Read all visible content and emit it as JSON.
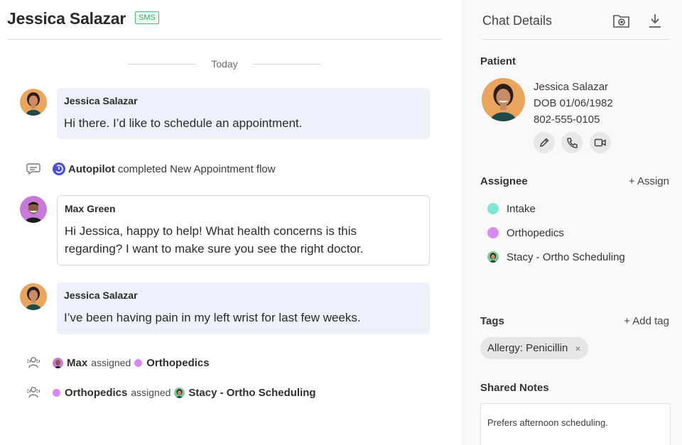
{
  "chat": {
    "title": "Jessica Salazar",
    "channel_badge": "SMS",
    "date_divider": "Today",
    "messages": [
      {
        "sender": "Jessica Salazar",
        "text": "Hi there. I’d like to schedule an appointment."
      },
      {
        "sender": "Max Green",
        "text": "Hi Jessica, happy to help! What health concerns is this regarding? I want to make sure you see the right doctor."
      },
      {
        "sender": "Jessica Salazar",
        "text": "I’ve been having pain in my left wrist for last few weeks."
      }
    ],
    "events": {
      "autopilot": {
        "actor": "Autopilot",
        "text": "completed New Appointment flow"
      },
      "assign1": {
        "actor": "Max",
        "verb": "assigned",
        "target": "Orthopedics"
      },
      "assign2": {
        "actor": "Orthopedics",
        "verb": "assigned",
        "target": "Stacy - Ortho Scheduling"
      }
    }
  },
  "details": {
    "title": "Chat Details",
    "patient_label": "Patient",
    "patient": {
      "name": "Jessica Salazar",
      "dob": "DOB 01/06/1982",
      "phone": "802-555-0105"
    },
    "assignee_label": "Assignee",
    "assign_action": "+ Assign",
    "assignees": [
      {
        "name": "Intake",
        "color": "#7ee8d4"
      },
      {
        "name": "Orthopedics",
        "color": "#d98af0"
      },
      {
        "name": "Stacy - Ortho Scheduling"
      }
    ],
    "tags_label": "Tags",
    "add_tag_action": "+ Add tag",
    "tags": [
      {
        "label": "Allergy: Penicillin",
        "remove": "×"
      }
    ],
    "notes_label": "Shared Notes",
    "notes_text": "Prefers afternoon scheduling."
  },
  "colors": {
    "patient_bubble": "#eef1fb",
    "sms_badge": "#2fae68",
    "autopilot": "#4a4fd8",
    "orthopedics": "#d98af0",
    "intake": "#7ee8d4"
  }
}
